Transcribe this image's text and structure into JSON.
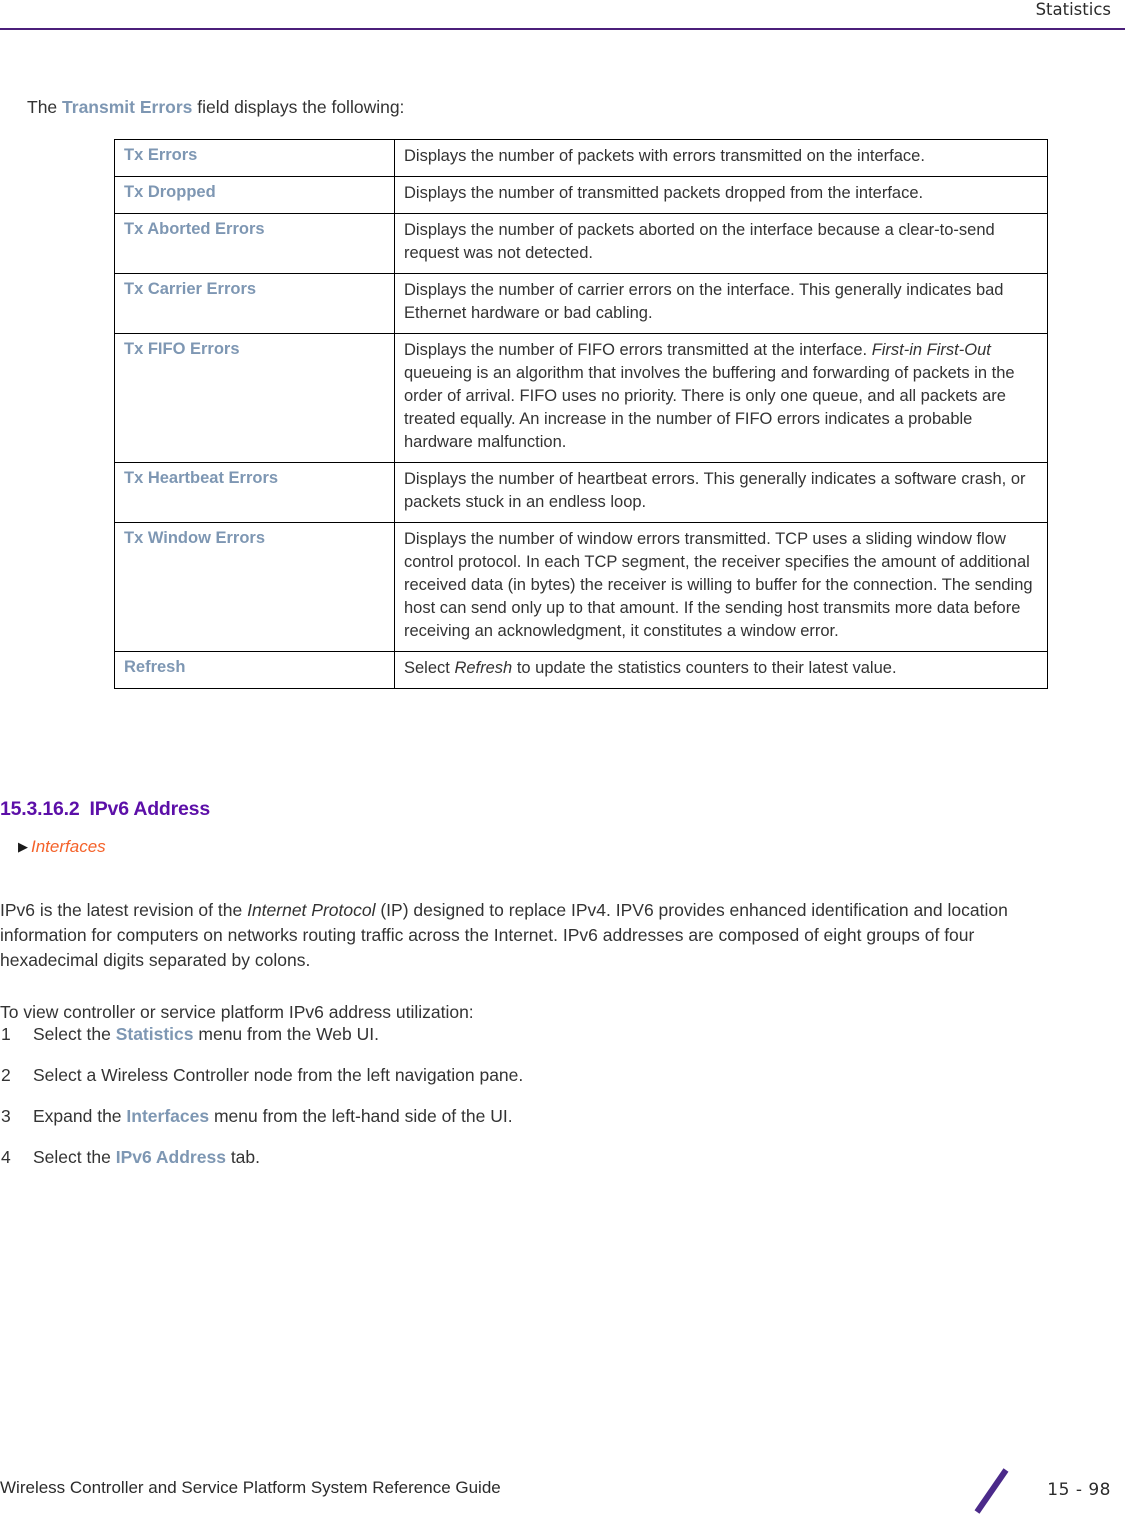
{
  "header": {
    "title": "Statistics",
    "rule_color": "#4b1f7a"
  },
  "intro": {
    "before": "The ",
    "keyword": "Transmit Errors",
    "after": " field displays the following:"
  },
  "table": {
    "rows": [
      {
        "label": "Tx Errors",
        "description": "Displays the number of packets with errors transmitted on the interface."
      },
      {
        "label": "Tx Dropped",
        "description": "Displays the number of transmitted packets dropped from the interface."
      },
      {
        "label": "Tx Aborted Errors",
        "description": "Displays the number of packets aborted on the interface because a clear-to-send request was not detected."
      },
      {
        "label": "Tx Carrier Errors",
        "description": "Displays the number of carrier errors on the interface. This generally indicates bad Ethernet hardware or bad cabling."
      },
      {
        "label": "Tx FIFO Errors",
        "description_part1": "Displays the number of FIFO errors transmitted at the interface. ",
        "description_italic": "First-in First-Out",
        "description_part2": " queueing is an algorithm that involves the buffering and forwarding of packets in the order of arrival. FIFO uses no priority. There is only one queue, and all packets are treated equally. An increase in the number of FIFO errors indicates a probable hardware malfunction."
      },
      {
        "label": "Tx Heartbeat Errors",
        "description": "Displays the number of heartbeat errors. This generally indicates a software crash, or packets stuck in an endless loop."
      },
      {
        "label": "Tx Window Errors",
        "description": "Displays the number of window errors transmitted. TCP uses a sliding window flow control protocol. In each TCP segment, the receiver specifies the amount of additional received data (in bytes) the receiver is willing to buffer for the connection. The sending host can send only up to that amount. If the sending host transmits more data before receiving an acknowledgment, it constitutes a window error."
      },
      {
        "label": "Refresh",
        "description_part1": "Select ",
        "description_italic": "Refresh",
        "description_part2": " to update the statistics counters to their latest value."
      }
    ]
  },
  "section": {
    "number": "15.3.16.2",
    "title": "IPv6 Address",
    "heading_color": "#5c0fa8",
    "breadcrumb": "Interfaces",
    "breadcrumb_color": "#f4622a",
    "breadcrumb_arrow": "▶"
  },
  "paragraphs": {
    "ipv6_part1": "IPv6 is the latest revision of the ",
    "ipv6_italic": "Internet Protocol",
    "ipv6_part2": " (IP) designed to replace IPv4. IPV6 provides enhanced identification and location information for computers on networks routing traffic across the Internet. IPv6 addresses are composed of eight groups of four hexadecimal digits separated by colons.",
    "to_view": "To view controller or service platform IPv6 address utilization:"
  },
  "steps": [
    {
      "num": "1",
      "before": "Select the ",
      "keyword": "Statistics",
      "after": " menu from the Web UI."
    },
    {
      "num": "2",
      "before": "Select a Wireless Controller node from the left navigation pane.",
      "keyword": "",
      "after": ""
    },
    {
      "num": "3",
      "before": "Expand the ",
      "keyword": "Interfaces",
      "after": " menu from the left-hand side of the UI."
    },
    {
      "num": "4",
      "before": "Select the ",
      "keyword": "IPv6 Address",
      "after": " tab."
    }
  ],
  "footer": {
    "title": "Wireless Controller and Service Platform System Reference Guide",
    "page_number": "15 - 98",
    "slash_color": "#4b2a8a"
  },
  "colors": {
    "keyword_blue": "#7e97b3",
    "body_text": "#333333",
    "table_border": "#000000"
  }
}
